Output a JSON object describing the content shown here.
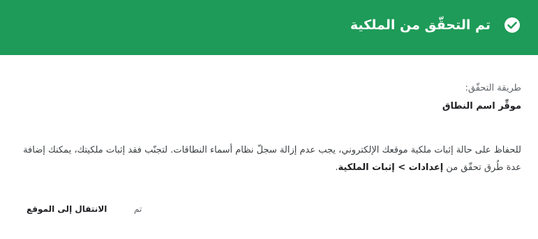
{
  "header": {
    "title": "تم التحقّق من الملكية",
    "icon": "check-circle-icon",
    "bg_color": "#1e9b58"
  },
  "verification": {
    "method_label": "طريقة التحقّق:",
    "method_value": "موفِّر اسم النطاق"
  },
  "info": {
    "text_before": "للحفاظ على حالة إثبات ملكية موقعك الإلكتروني، يجب عدم إزالة سجلّ نظام أسماء النطاقات. لتجنّب فقد إثبات ملكيتك، يمكنك إضافة عدة طُرق تحقّق من ",
    "settings": "إعدادات",
    "separator": " > ",
    "ownership": "إثبات الملكية",
    "text_after": "."
  },
  "actions": {
    "done_label": "تم",
    "goto_label": "الانتقال إلى الموقع"
  }
}
